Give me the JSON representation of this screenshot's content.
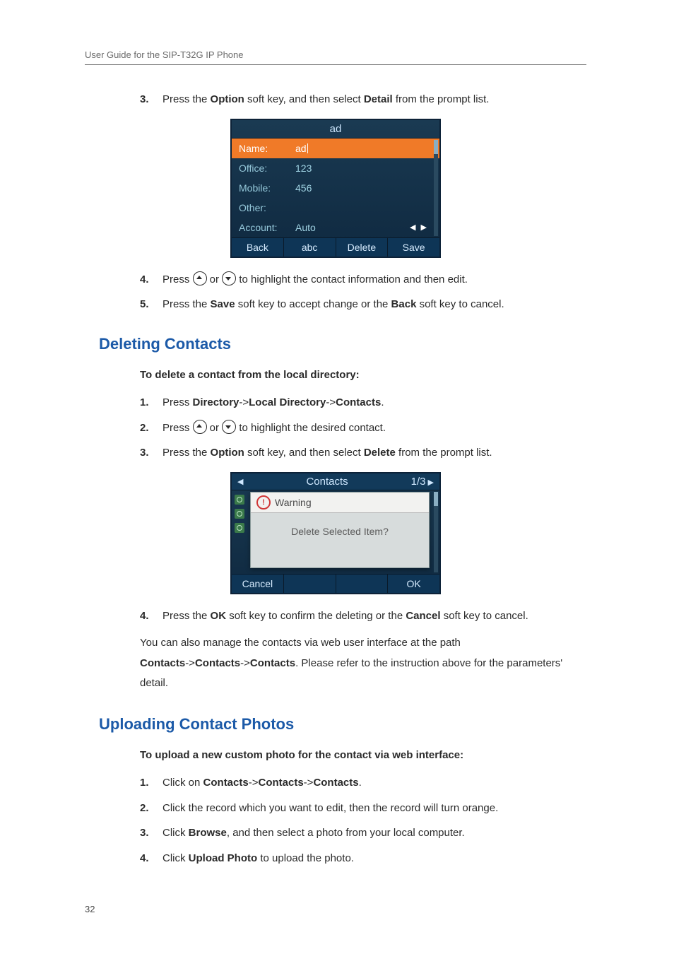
{
  "header": {
    "title": "User Guide for the SIP-T32G IP Phone"
  },
  "page_number": "32",
  "step3_top": {
    "num": "3.",
    "pre": "Press the ",
    "bold1": "Option",
    "mid": " soft key, and then select ",
    "bold2": "Detail",
    "post": " from the prompt list."
  },
  "phone1": {
    "title": "ad",
    "rows": {
      "name_label": "Name:",
      "name_value": "ad",
      "office_label": "Office:",
      "office_value": "123",
      "mobile_label": "Mobile:",
      "mobile_value": "456",
      "other_label": "Other:",
      "other_value": "",
      "account_label": "Account:",
      "account_value": "Auto"
    },
    "softkeys": {
      "sk1": "Back",
      "sk2": "abc",
      "sk3": "Delete",
      "sk4": "Save"
    }
  },
  "step4": {
    "num": "4.",
    "pre": "Press ",
    "mid": " or ",
    "post": " to highlight the contact information and then edit."
  },
  "step5": {
    "num": "5.",
    "pre": "Press the ",
    "bold1": "Save",
    "mid": " soft key to accept change or the ",
    "bold2": "Back",
    "post": " soft key to cancel."
  },
  "heading_delete": "Deleting Contacts",
  "delete_intro": "To delete a contact from the local directory:",
  "dstep1": {
    "num": "1.",
    "pre": "Press ",
    "b1": "Directory",
    "a1": "->",
    "b2": "Local Directory",
    "a2": "->",
    "b3": "Contacts",
    "end": "."
  },
  "dstep2": {
    "num": "2.",
    "pre": "Press ",
    "mid": " or ",
    "post": " to highlight the desired contact."
  },
  "dstep3": {
    "num": "3.",
    "pre": "Press the ",
    "bold1": "Option",
    "mid": " soft key, and then select ",
    "bold2": "Delete",
    "post": " from the prompt list."
  },
  "phone2": {
    "title": "Contacts",
    "page": "1/3",
    "warning_label": "Warning",
    "message": "Delete Selected Item?",
    "sk_cancel": "Cancel",
    "sk_ok": "OK"
  },
  "dstep4": {
    "num": "4.",
    "pre": "Press the ",
    "bold1": "OK",
    "mid": " soft key to confirm the deleting or the ",
    "bold2": "Cancel",
    "post": " soft key to cancel."
  },
  "delete_para": {
    "l1": "You can also manage the contacts via web user interface at the path ",
    "b1": "Contacts",
    "a1": "->",
    "b2": "Contacts",
    "a2": "->",
    "b3": "Contacts",
    "l2": ". Please refer to the instruction above for the parameters' detail."
  },
  "heading_upload": "Uploading Contact Photos",
  "upload_intro": "To upload a new custom photo for the contact via web interface:",
  "ustep1": {
    "num": "1.",
    "pre": "Click on ",
    "b1": "Contacts",
    "a1": "->",
    "b2": "Contacts",
    "a2": "->",
    "b3": "Contacts",
    "end": "."
  },
  "ustep2": {
    "num": "2.",
    "text": "Click the record which you want to edit, then the record will turn orange."
  },
  "ustep3": {
    "num": "3.",
    "pre": "Click ",
    "b1": "Browse",
    "post": ", and then select a photo from your local computer."
  },
  "ustep4": {
    "num": "4.",
    "pre": "Click ",
    "b1": "Upload Photo",
    "post": " to upload the photo."
  }
}
